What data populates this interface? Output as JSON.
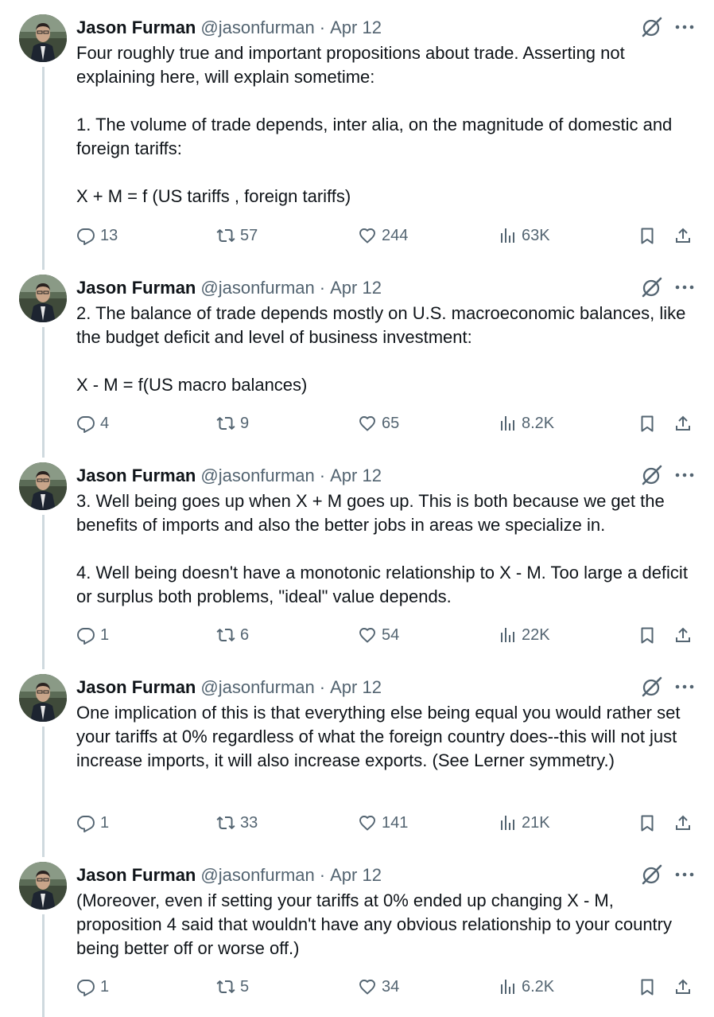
{
  "tweets": [
    {
      "name": "Jason Furman",
      "handle": "@jasonfurman",
      "separator": "·",
      "date": "Apr 12",
      "paragraphs": [
        "Four roughly true and important propositions about trade. Asserting not explaining here, will explain sometime:",
        "1. The volume of trade depends, inter alia, on the magnitude of domestic and foreign tariffs:",
        "X + M = f (US tariffs , foreign tariffs)"
      ],
      "replies": "13",
      "reposts": "57",
      "likes": "244",
      "views": "63K"
    },
    {
      "name": "Jason Furman",
      "handle": "@jasonfurman",
      "separator": "·",
      "date": "Apr 12",
      "paragraphs": [
        "2. The balance of trade depends mostly on U.S. macroeconomic balances, like the budget deficit and level of business investment:",
        "X - M = f(US macro balances)"
      ],
      "replies": "4",
      "reposts": "9",
      "likes": "65",
      "views": "8.2K"
    },
    {
      "name": "Jason Furman",
      "handle": "@jasonfurman",
      "separator": "·",
      "date": "Apr 12",
      "paragraphs": [
        "3. Well being goes up when X + M goes up. This is both because we get the benefits of imports and also the better jobs in areas we specialize in.",
        "4. Well being doesn't have a monotonic relationship to X - M. Too large a deficit or surplus both problems, \"ideal\" value depends."
      ],
      "replies": "1",
      "reposts": "6",
      "likes": "54",
      "views": "22K"
    },
    {
      "name": "Jason Furman",
      "handle": "@jasonfurman",
      "separator": "·",
      "date": "Apr 12",
      "paragraphs": [
        "One implication of this is that everything else being equal you would rather set your tariffs at 0% regardless of what the foreign country does--this will not just increase imports, it will also increase exports. (See Lerner symmetry.)"
      ],
      "replies": "1",
      "reposts": "33",
      "likes": "141",
      "views": "21K"
    },
    {
      "name": "Jason Furman",
      "handle": "@jasonfurman",
      "separator": "·",
      "date": "Apr 12",
      "paragraphs": [
        "(Moreover, even if setting your tariffs at 0% ended up changing X - M, proposition 4 said that wouldn't have any obvious relationship to your country being better off or worse off.)"
      ],
      "replies": "1",
      "reposts": "5",
      "likes": "34",
      "views": "6.2K"
    }
  ],
  "icons": {
    "reply": "reply-icon",
    "repost": "repost-icon",
    "like": "heart-icon",
    "views": "views-icon",
    "bookmark": "bookmark-icon",
    "share": "share-icon",
    "grok": "grok-icon",
    "more": "more-icon"
  },
  "colors": {
    "text": "#0f1419",
    "secondary": "#536471",
    "thread_line": "#cfd9de"
  }
}
